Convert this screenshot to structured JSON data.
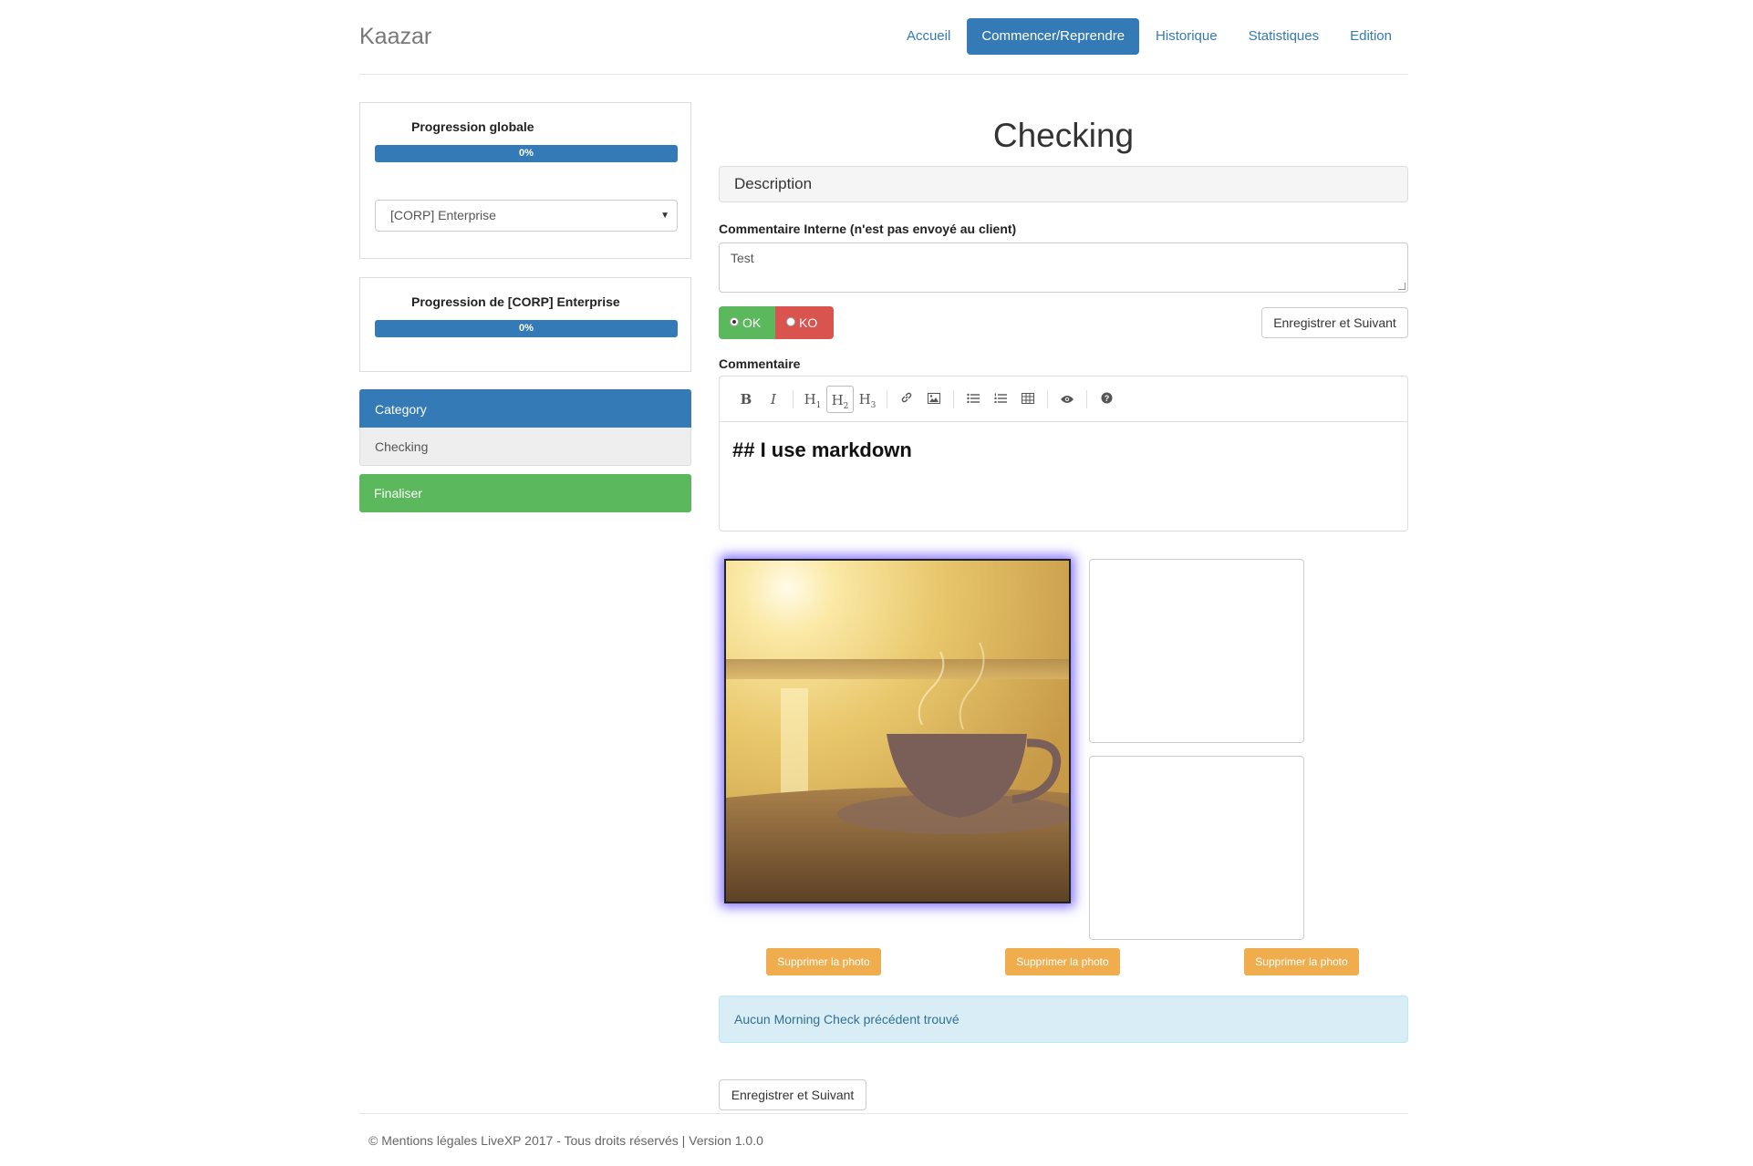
{
  "brand": "Kaazar",
  "nav": {
    "items": [
      "Accueil",
      "Commencer/Reprendre",
      "Historique",
      "Statistiques",
      "Edition"
    ],
    "active": "Commencer/Reprendre"
  },
  "sidebar": {
    "global_progress": {
      "title": "Progression globale",
      "percent_label": "0%",
      "percent": 0
    },
    "select": {
      "selected": "[CORP] Enterprise"
    },
    "section_progress": {
      "title": "Progression de [CORP] Enterprise",
      "percent_label": "0%",
      "percent": 0
    },
    "category_header": "Category",
    "category_item": "Checking",
    "finalize_label": "Finaliser"
  },
  "main": {
    "title": "Checking",
    "description_label": "Description",
    "internal_comment_label": "Commentaire Interne (n'est pas envoyé au client)",
    "internal_comment_value": "Test",
    "ok_label": "OK",
    "ko_label": "KO",
    "save_next_label": "Enregistrer et Suivant",
    "comment_label": "Commentaire",
    "editor_toolbar": [
      "bold-icon",
      "italic-icon",
      "heading-1-icon",
      "heading-2-icon",
      "heading-3-icon",
      "link-icon",
      "image-icon",
      "unordered-list-icon",
      "ordered-list-icon",
      "table-icon",
      "preview-icon",
      "help-icon"
    ],
    "editor_content": "## I use markdown",
    "delete_photo_label": "Supprimer la photo",
    "alert_text": "Aucun Morning Check précédent trouvé",
    "bottom_save_label": "Enregistrer et Suivant"
  },
  "footer": {
    "text": "© Mentions légales LiveXP 2017 - Tous droits réservés | Version 1.0.0"
  },
  "colors": {
    "primary": "#337ab7",
    "success": "#5cb85c",
    "danger": "#d9534f",
    "warning": "#f0ad4e",
    "info_bg": "#d9edf7"
  }
}
